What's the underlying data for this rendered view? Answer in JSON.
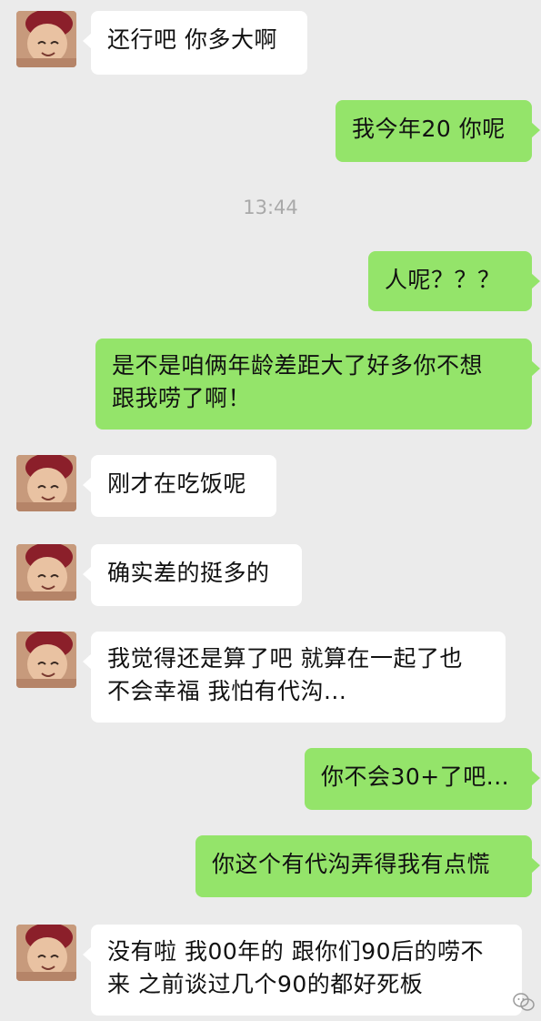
{
  "timestamp": "13:44",
  "messages": [
    {
      "side": "left",
      "text": "还行吧 你多大啊"
    },
    {
      "side": "right",
      "text": "我今年20 你呢"
    },
    {
      "side": "right",
      "text": "人呢？？？"
    },
    {
      "side": "right",
      "lines": [
        "是不是咱俩年龄差距大了好多你不想",
        "跟我唠了啊！"
      ]
    },
    {
      "side": "left",
      "text": "刚才在吃饭呢"
    },
    {
      "side": "left",
      "text": "确实差的挺多的"
    },
    {
      "side": "left",
      "lines": [
        "我觉得还是算了吧 就算在一起了也",
        "不会幸福 我怕有代沟..."
      ]
    },
    {
      "side": "right",
      "text": "你不会30+了吧..."
    },
    {
      "side": "right",
      "text": "你这个有代沟弄得我有点慌"
    },
    {
      "side": "left",
      "lines": [
        "没有啦 我00年的 跟你们90后的唠不",
        "来 之前谈过几个90的都好死板"
      ]
    }
  ],
  "colors": {
    "background": "#ebebeb",
    "incoming_bubble": "#ffffff",
    "outgoing_bubble": "#94e46a",
    "timestamp": "#a9a9a9"
  },
  "icons": {
    "avatar": "girl-avatar-icon",
    "watermark": "wechat-watermark-icon"
  }
}
